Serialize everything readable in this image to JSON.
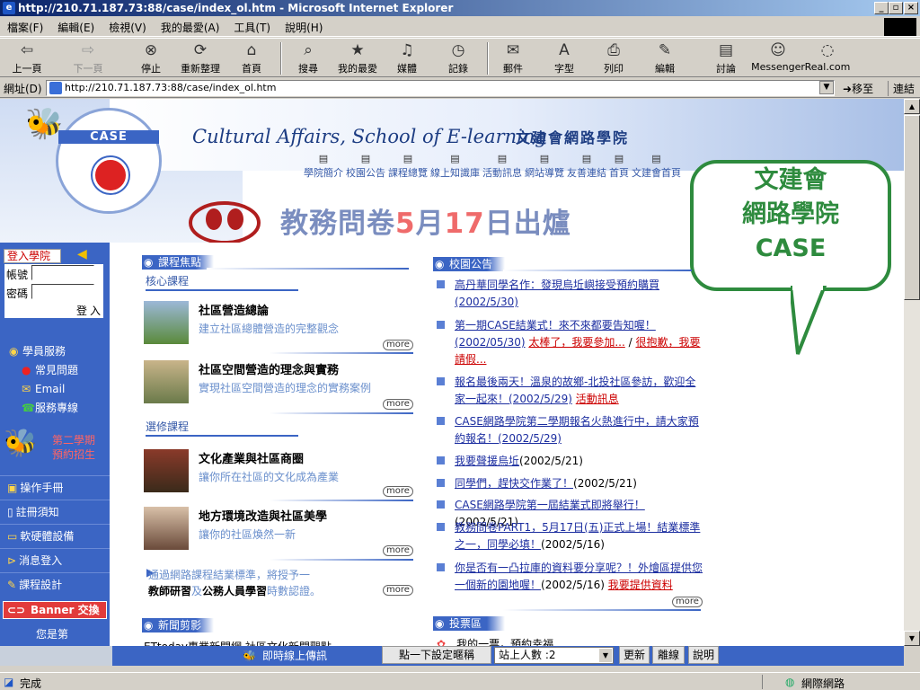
{
  "window": {
    "title": "http://210.71.187.73:88/case/index_ol.htm - Microsoft Internet Explorer"
  },
  "menu": [
    "檔案(F)",
    "編輯(E)",
    "檢視(V)",
    "我的最愛(A)",
    "工具(T)",
    "說明(H)"
  ],
  "toolbar": {
    "back": "上一頁",
    "forward": "下一頁",
    "stop": "停止",
    "refresh": "重新整理",
    "home": "首頁",
    "search": "搜尋",
    "favorites": "我的最愛",
    "media": "媒體",
    "history": "記錄",
    "mail": "郵件",
    "font": "字型",
    "print": "列印",
    "edit": "編輯",
    "discuss": "討論",
    "messenger": "Messenger",
    "real": "Real.com"
  },
  "address": {
    "label": "網址(D)",
    "url": "http://210.71.187.73:88/case/index_ol.htm",
    "go": "移至",
    "links": "連結"
  },
  "banner": {
    "title_en": "Cultural Affairs, School of E-learning",
    "title_zh": "文建會網路學院",
    "nav": [
      "學院簡介",
      "校園公告",
      "課程總覽",
      "線上知識庫",
      "活動訊息",
      "網站導覽",
      "友善連結",
      "首頁",
      "文建會首頁"
    ],
    "promo_pre": "教務問卷",
    "promo_m": "5",
    "promo_mid": "月",
    "promo_d": "17",
    "promo_post": "日出爐",
    "seal_text": "CASE"
  },
  "bubble": {
    "line1": "文建會",
    "line2": "網路學院",
    "line3": "CASE"
  },
  "login": {
    "tab": "登入學院",
    "account": "帳號",
    "password": "密碼",
    "button": "登入"
  },
  "leftnav": {
    "services": "學員服務",
    "faq": "常見問題",
    "email": "Email",
    "hotline": "服務專線",
    "enroll1": "第二學期",
    "enroll2": "預約招生",
    "manual": "操作手冊",
    "notice": "註冊須知",
    "software": "軟硬體設備",
    "msg": "消息登入",
    "design": "課程設計",
    "banner_btn": "Banner 交換",
    "you_are": "您是第"
  },
  "courses": {
    "section": "課程焦點",
    "core": "核心課程",
    "elective": "選修課程",
    "items": [
      {
        "title": "社區營造總論",
        "desc": "建立社區總體營造的完整觀念"
      },
      {
        "title": "社區空間營造的理念與實務",
        "desc": "實現社區空間營造的理念的實務案例"
      },
      {
        "title": "文化產業與社區商圈",
        "desc": "讓你所在社區的文化成為產業"
      },
      {
        "title": "地方環境改造與社區美學",
        "desc": "讓你的社區煥然一新"
      }
    ],
    "more": "more",
    "cert_pre": "通過網路課程結業標準，將授予一",
    "cert_a": "教師研習",
    "cert_b": "及",
    "cert_c": "公務人員學習",
    "cert_post": "時數認證。",
    "news_clip": "新聞剪影",
    "news_clip_text": "ETtoday專業新聞網 社區文化新聞觀點"
  },
  "news": {
    "section": "校園公告",
    "items": [
      {
        "a": "高丹華同學名作：發現烏坵嶼接受預約購買(2002/5/30)"
      },
      {
        "a": "第一期CASE結業式！來不來都要告知喔！(2002/05/30)",
        "r1": "太棒了，我要參加...",
        "sep": " / ",
        "r2": "很抱歉，我要請假..."
      },
      {
        "a": "報名最後兩天！溫泉的故鄉-北投社區參訪，歡迎全家一起來！(2002/5/29)",
        "r1": "活動訊息"
      },
      {
        "a": "CASE網路學院第二學期報名火熱進行中，請大家預約報名！(2002/5/29)"
      },
      {
        "a": "我要聲援烏坵",
        "t": "(2002/5/21)"
      },
      {
        "a": "同學們，趕快交作業了！",
        "t": "(2002/5/21)"
      },
      {
        "a": "CASE網路學院第一屆結業式即將舉行！",
        "t": "(2002/5/21)"
      },
      {
        "a": "教務問卷PART1，5月17日(五)正式上場！結業標準之一，同學必填！",
        "t": "(2002/5/16)"
      },
      {
        "a": "你是否有一凸拉庫的資料要分享呢？！外燴區提供您一個新的園地喔！",
        "t": "(2002/5/16)",
        "r1": "我要提供資料"
      }
    ],
    "more": "more",
    "vote": "投票區",
    "vote_text": "我的一票，預約幸福"
  },
  "footer": {
    "upload": "即時線上傳訊",
    "set": "點一下設定暱稱",
    "online": "站上人數 :2",
    "update": "更新",
    "leave": "離線",
    "help": "說明"
  },
  "status": {
    "left": "完成",
    "zone": "網際網路"
  }
}
